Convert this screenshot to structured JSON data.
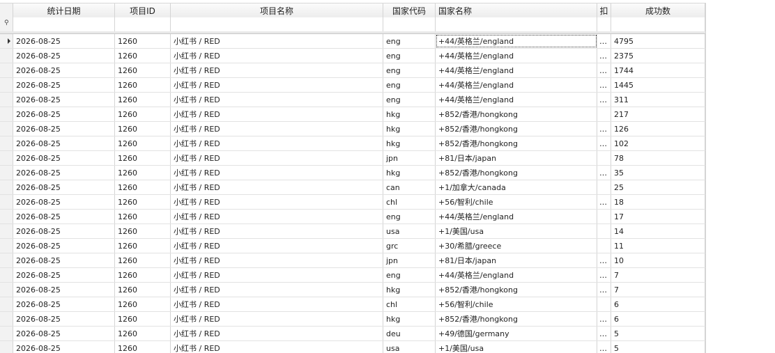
{
  "columns": [
    "统计日期",
    "项目ID",
    "项目名称",
    "国家代码",
    "国家名称",
    "扣",
    "成功数"
  ],
  "filter_icon": "pin-icon",
  "rows": [
    {
      "date": "2026-08-25",
      "pid": "1260",
      "pname": "小红书 / RED",
      "code": "eng",
      "country": "+44/英格兰/england",
      "ell": "…",
      "count": "4795"
    },
    {
      "date": "2026-08-25",
      "pid": "1260",
      "pname": "小红书 / RED",
      "code": "eng",
      "country": "+44/英格兰/england",
      "ell": "…",
      "count": "2375"
    },
    {
      "date": "2026-08-25",
      "pid": "1260",
      "pname": "小红书 / RED",
      "code": "eng",
      "country": "+44/英格兰/england",
      "ell": "…",
      "count": "1744"
    },
    {
      "date": "2026-08-25",
      "pid": "1260",
      "pname": "小红书 / RED",
      "code": "eng",
      "country": "+44/英格兰/england",
      "ell": "…",
      "count": "1445"
    },
    {
      "date": "2026-08-25",
      "pid": "1260",
      "pname": "小红书 / RED",
      "code": "eng",
      "country": "+44/英格兰/england",
      "ell": "…",
      "count": "311"
    },
    {
      "date": "2026-08-25",
      "pid": "1260",
      "pname": "小红书 / RED",
      "code": "hkg",
      "country": "+852/香港/hongkong",
      "ell": "",
      "count": "217"
    },
    {
      "date": "2026-08-25",
      "pid": "1260",
      "pname": "小红书 / RED",
      "code": "hkg",
      "country": "+852/香港/hongkong",
      "ell": "…",
      "count": "126"
    },
    {
      "date": "2026-08-25",
      "pid": "1260",
      "pname": "小红书 / RED",
      "code": "hkg",
      "country": "+852/香港/hongkong",
      "ell": "…",
      "count": "102"
    },
    {
      "date": "2026-08-25",
      "pid": "1260",
      "pname": "小红书 / RED",
      "code": "jpn",
      "country": "+81/日本/japan",
      "ell": "",
      "count": "78"
    },
    {
      "date": "2026-08-25",
      "pid": "1260",
      "pname": "小红书 / RED",
      "code": "hkg",
      "country": "+852/香港/hongkong",
      "ell": "…",
      "count": "35"
    },
    {
      "date": "2026-08-25",
      "pid": "1260",
      "pname": "小红书 / RED",
      "code": "can",
      "country": "+1/加拿大/canada",
      "ell": "",
      "count": "25"
    },
    {
      "date": "2026-08-25",
      "pid": "1260",
      "pname": "小红书 / RED",
      "code": "chl",
      "country": "+56/智利/chile",
      "ell": "…",
      "count": "18"
    },
    {
      "date": "2026-08-25",
      "pid": "1260",
      "pname": "小红书 / RED",
      "code": "eng",
      "country": "+44/英格兰/england",
      "ell": "",
      "count": "17"
    },
    {
      "date": "2026-08-25",
      "pid": "1260",
      "pname": "小红书 / RED",
      "code": "usa",
      "country": "+1/美国/usa",
      "ell": "",
      "count": "14"
    },
    {
      "date": "2026-08-25",
      "pid": "1260",
      "pname": "小红书 / RED",
      "code": "grc",
      "country": "+30/希腊/greece",
      "ell": "",
      "count": "11"
    },
    {
      "date": "2026-08-25",
      "pid": "1260",
      "pname": "小红书 / RED",
      "code": "jpn",
      "country": "+81/日本/japan",
      "ell": "…",
      "count": "10"
    },
    {
      "date": "2026-08-25",
      "pid": "1260",
      "pname": "小红书 / RED",
      "code": "eng",
      "country": "+44/英格兰/england",
      "ell": "…",
      "count": "7"
    },
    {
      "date": "2026-08-25",
      "pid": "1260",
      "pname": "小红书 / RED",
      "code": "hkg",
      "country": "+852/香港/hongkong",
      "ell": "…",
      "count": "7"
    },
    {
      "date": "2026-08-25",
      "pid": "1260",
      "pname": "小红书 / RED",
      "code": "chl",
      "country": "+56/智利/chile",
      "ell": "",
      "count": "6"
    },
    {
      "date": "2026-08-25",
      "pid": "1260",
      "pname": "小红书 / RED",
      "code": "hkg",
      "country": "+852/香港/hongkong",
      "ell": "…",
      "count": "6"
    },
    {
      "date": "2026-08-25",
      "pid": "1260",
      "pname": "小红书 / RED",
      "code": "deu",
      "country": "+49/德国/germany",
      "ell": "…",
      "count": "5"
    },
    {
      "date": "2026-08-25",
      "pid": "1260",
      "pname": "小红书 / RED",
      "code": "usa",
      "country": "+1/美国/usa",
      "ell": "…",
      "count": "5"
    }
  ]
}
